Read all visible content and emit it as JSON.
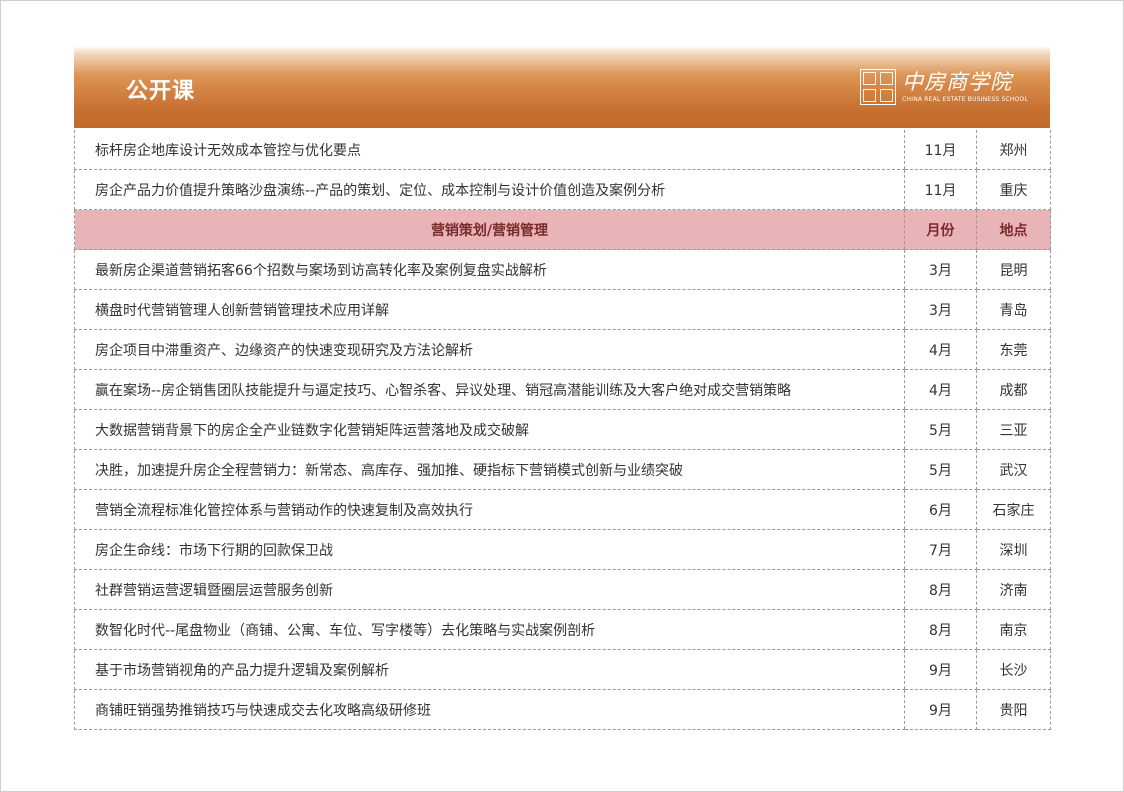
{
  "header": {
    "title": "公开课",
    "logo_cn": "中房商学院",
    "logo_en": "CHINA REAL ESTATE BUSINESS SCHOOL"
  },
  "rows_top": [
    {
      "name": "标杆房企地库设计无效成本管控与优化要点",
      "month": "11月",
      "city": "郑州"
    },
    {
      "name": "房企产品力价值提升策略沙盘演练--产品的策划、定位、成本控制与设计价值创造及案例分析",
      "month": "11月",
      "city": "重庆"
    }
  ],
  "section": {
    "name": "营销策划/营销管理",
    "month": "月份",
    "city": "地点"
  },
  "rows": [
    {
      "name": "最新房企渠道营销拓客66个招数与案场到访高转化率及案例复盘实战解析",
      "month": "3月",
      "city": "昆明"
    },
    {
      "name": "横盘时代营销管理人创新营销管理技术应用详解",
      "month": "3月",
      "city": "青岛"
    },
    {
      "name": "房企项目中滞重资产、边缘资产的快速变现研究及方法论解析",
      "month": "4月",
      "city": "东莞"
    },
    {
      "name": "赢在案场--房企销售团队技能提升与逼定技巧、心智杀客、异议处理、销冠高潜能训练及大客户绝对成交营销策略",
      "month": "4月",
      "city": "成都"
    },
    {
      "name": "大数据营销背景下的房企全产业链数字化营销矩阵运营落地及成交破解",
      "month": "5月",
      "city": "三亚"
    },
    {
      "name": "决胜，加速提升房企全程营销力：新常态、高库存、强加推、硬指标下营销模式创新与业绩突破",
      "month": "5月",
      "city": "武汉"
    },
    {
      "name": "营销全流程标准化管控体系与营销动作的快速复制及高效执行",
      "month": "6月",
      "city": "石家庄"
    },
    {
      "name": "房企生命线：市场下行期的回款保卫战",
      "month": "7月",
      "city": "深圳"
    },
    {
      "name": "社群营销运营逻辑暨圈层运营服务创新",
      "month": "8月",
      "city": "济南"
    },
    {
      "name": "数智化时代--尾盘物业（商铺、公寓、车位、写字楼等）去化策略与实战案例剖析",
      "month": "8月",
      "city": "南京"
    },
    {
      "name": "基于市场营销视角的产品力提升逻辑及案例解析",
      "month": "9月",
      "city": "长沙"
    },
    {
      "name": "商铺旺销强势推销技巧与快速成交去化攻略高级研修班",
      "month": "9月",
      "city": "贵阳"
    }
  ]
}
